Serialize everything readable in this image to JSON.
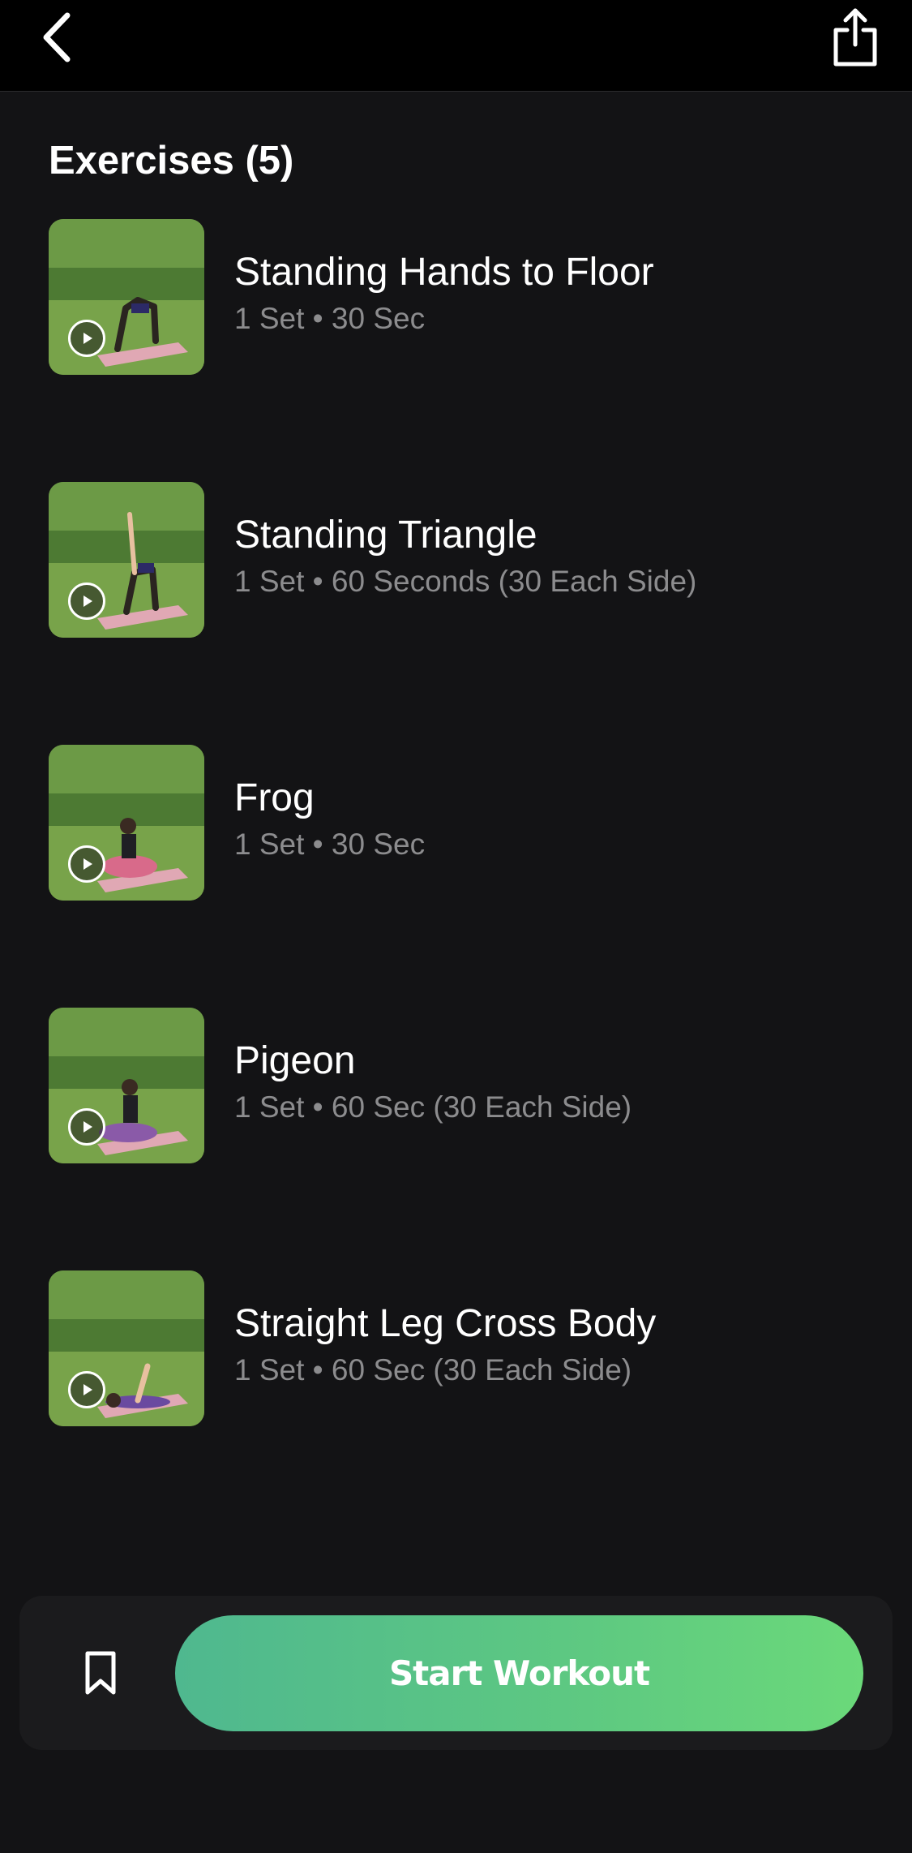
{
  "header": {
    "back_icon": "chevron-left-icon",
    "share_icon": "share-icon"
  },
  "section": {
    "title": "Exercises (5)"
  },
  "exercises": [
    {
      "name": "Standing Hands to Floor",
      "detail": "1 Set • 30 Sec"
    },
    {
      "name": "Standing Triangle",
      "detail": "1 Set • 60 Seconds (30 Each Side)"
    },
    {
      "name": "Frog",
      "detail": "1 Set • 30 Sec"
    },
    {
      "name": "Pigeon",
      "detail": "1 Set • 60 Sec (30 Each Side)"
    },
    {
      "name": "Straight Leg Cross Body",
      "detail": "1 Set • 60 Sec (30 Each Side)"
    }
  ],
  "footer": {
    "bookmark_icon": "bookmark-icon",
    "start_label": "Start Workout"
  },
  "colors": {
    "background": "#131315",
    "topbar": "#000000",
    "accent_start": "#4fb88f",
    "accent_end": "#6bd97a",
    "secondary_text": "#8c8c8e"
  }
}
